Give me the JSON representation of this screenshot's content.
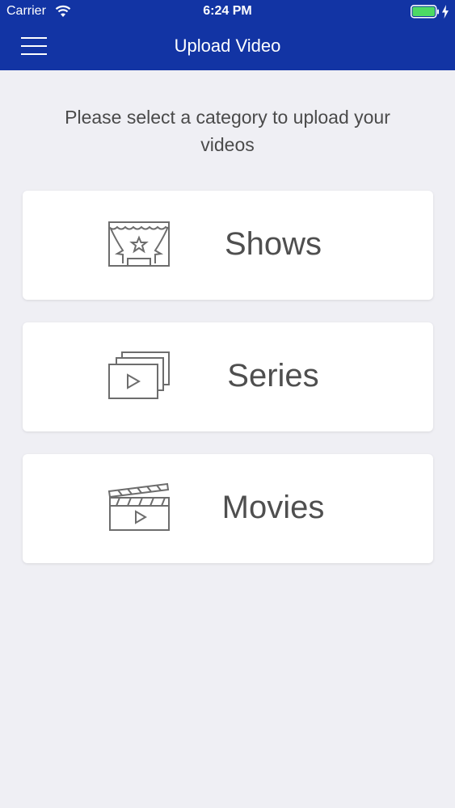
{
  "status_bar": {
    "carrier": "Carrier",
    "time": "6:24 PM",
    "battery_color": "#4cd964"
  },
  "nav": {
    "title": "Upload Video",
    "menu_icon": "hamburger-menu-icon",
    "background": "#1234a4"
  },
  "instructions": "Please select a category to upload your videos",
  "categories": [
    {
      "label": "Shows",
      "icon": "theater-stage-icon"
    },
    {
      "label": "Series",
      "icon": "video-stack-icon"
    },
    {
      "label": "Movies",
      "icon": "clapperboard-icon"
    }
  ]
}
